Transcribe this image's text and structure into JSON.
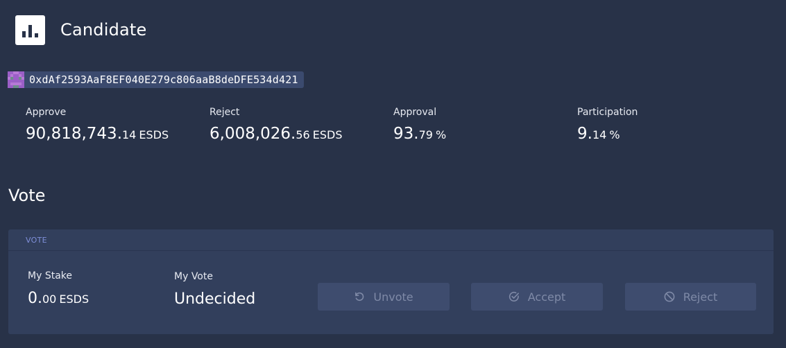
{
  "header": {
    "title": "Candidate",
    "logo_icon": "bar-chart-icon"
  },
  "candidate": {
    "address": "0xdAf2593AaF8EF040E279c806aaB8deDFE534d421"
  },
  "stats": [
    {
      "label": "Approve",
      "whole": "90,818,743.",
      "decimal": "14",
      "unit": "ESDS"
    },
    {
      "label": "Reject",
      "whole": "6,008,026.",
      "decimal": "56",
      "unit": "ESDS"
    },
    {
      "label": "Approval",
      "whole": "93.",
      "decimal": "79",
      "unit": "%"
    },
    {
      "label": "Participation",
      "whole": "9.",
      "decimal": "14",
      "unit": "%"
    }
  ],
  "vote": {
    "heading": "Vote",
    "panel_label": "VOTE",
    "my_stake": {
      "label": "My Stake",
      "whole": "0.",
      "decimal": "00",
      "unit": "ESDS"
    },
    "my_vote": {
      "label": "My Vote",
      "value": "Undecided"
    },
    "buttons": [
      {
        "label": "Unvote",
        "icon": "undo-icon"
      },
      {
        "label": "Accept",
        "icon": "check-circle-icon"
      },
      {
        "label": "Reject",
        "icon": "block-icon"
      }
    ]
  },
  "colors": {
    "background": "#283248",
    "panel": "#323f5c",
    "button": "#3e4c6e",
    "button_text": "#7f8aa7",
    "panel_label": "#7f8fd9"
  }
}
